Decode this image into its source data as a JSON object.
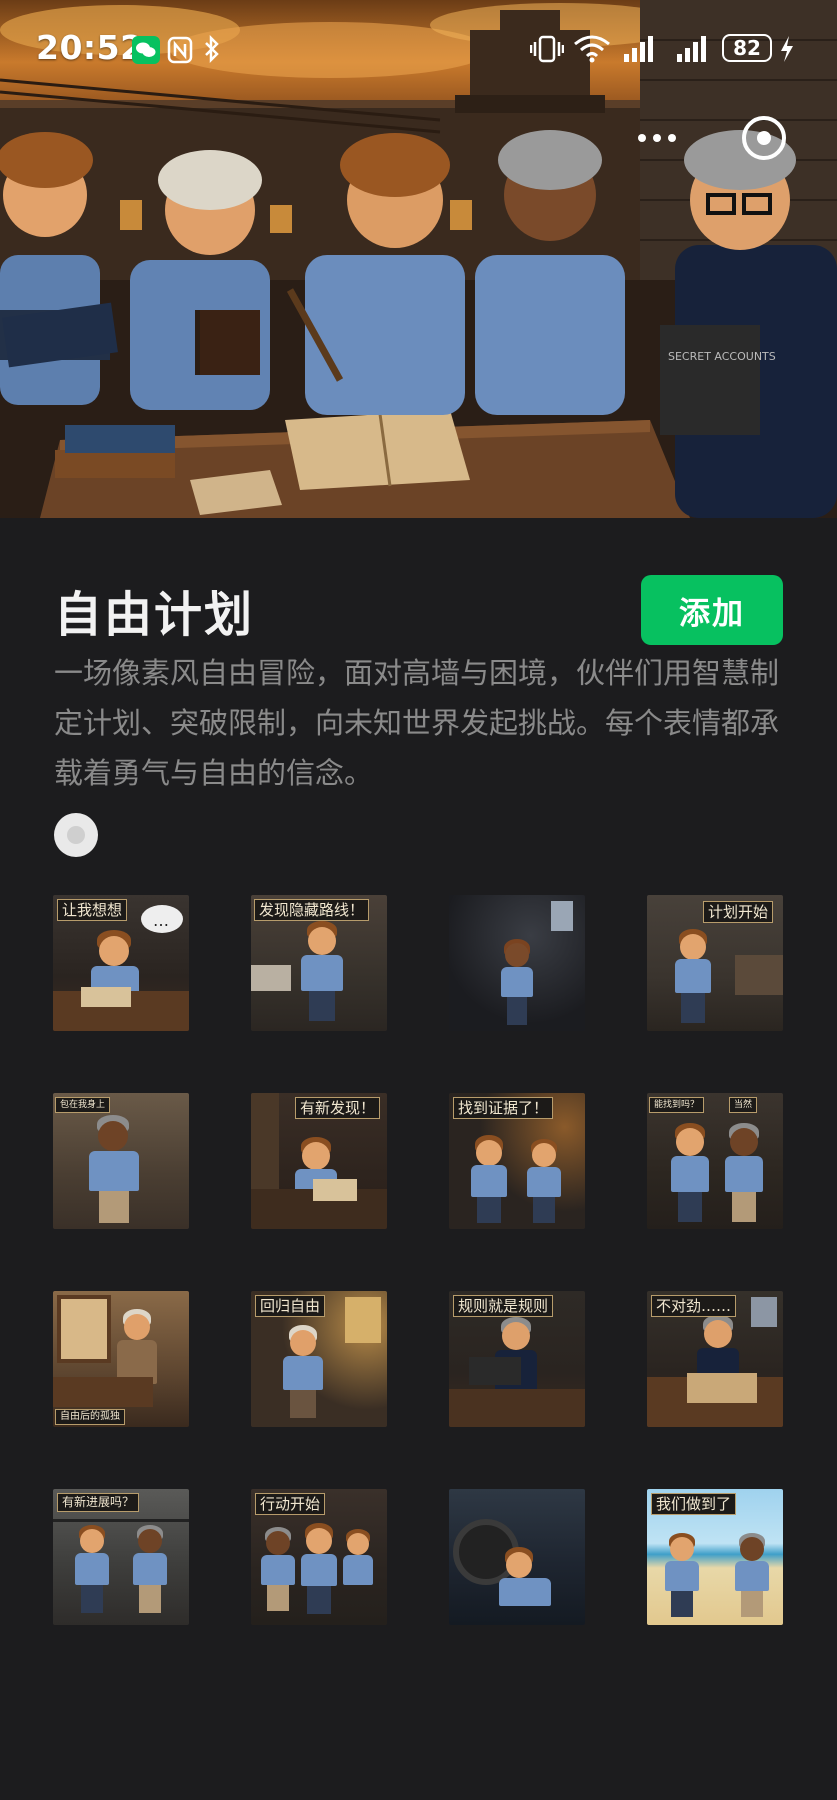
{
  "status_bar": {
    "time": "20:52",
    "battery": "82",
    "icons": [
      "wechat-icon",
      "nfc-icon",
      "bluetooth-icon",
      "vibrate-icon",
      "wifi-icon",
      "signal-icon",
      "signal-icon",
      "charging-icon"
    ]
  },
  "capsule": {
    "more_icon": "more-icon",
    "close_icon": "target-icon"
  },
  "pack": {
    "title": "自由计划",
    "add_label": "添加",
    "description": "一场像素风自由冒险，面对高墙与困境，伙伴们用智慧制定计划、突破限制，向未知世界发起挑战。每个表情都承载着勇气与自由的信念。",
    "hero_book_text": "SECRET ACCOUNTS"
  },
  "stickers": [
    {
      "caption": "让我想想",
      "extra": "…"
    },
    {
      "caption": "发现隐藏路线！"
    },
    {
      "caption": ""
    },
    {
      "caption": "计划开始"
    },
    {
      "caption": "包在我身上"
    },
    {
      "caption": "有新发现！"
    },
    {
      "caption": "找到证据了！"
    },
    {
      "caption": "能找到吗？",
      "extra": "当然"
    },
    {
      "caption": "自由后的孤独"
    },
    {
      "caption": "回归自由"
    },
    {
      "caption": "规则就是规则"
    },
    {
      "caption": "不对劲……"
    },
    {
      "caption": "有新进展吗？"
    },
    {
      "caption": "行动开始"
    },
    {
      "caption": ""
    },
    {
      "caption": "我们做到了"
    }
  ],
  "colors": {
    "add_button": "#07c160",
    "background": "#1c1c1e",
    "description_text": "#8a8a8a"
  }
}
